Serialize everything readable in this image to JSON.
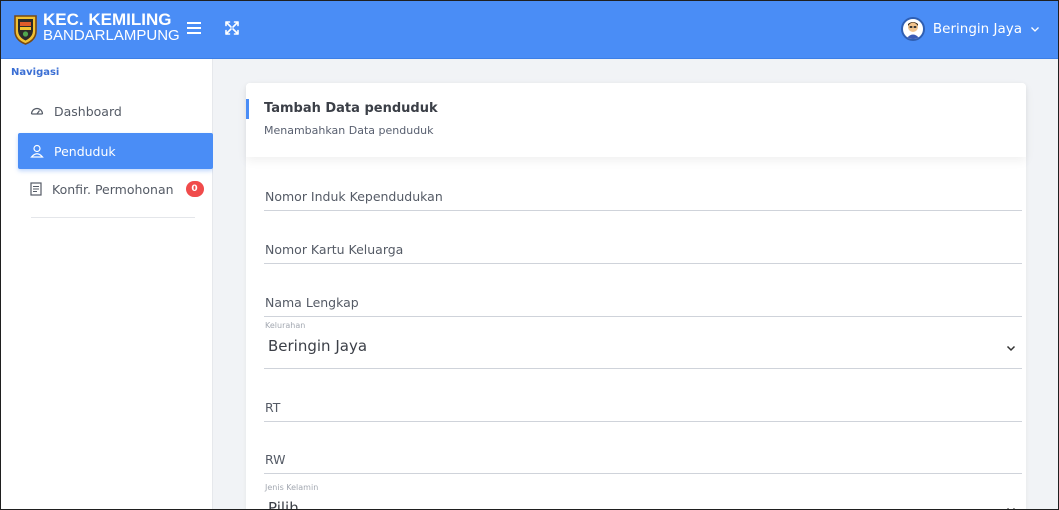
{
  "header": {
    "brand_title": "KEC. KEMILING",
    "brand_subtitle": "BANDARLAMPUNG",
    "user_name": "Beringin Jaya",
    "bar_color": "#4a8df6"
  },
  "sidebar": {
    "heading": "Navigasi",
    "items": [
      {
        "label": "Dashboard",
        "icon": "dashboard-gauge-icon",
        "active": false
      },
      {
        "label": "Penduduk",
        "icon": "user-icon",
        "active": true
      },
      {
        "label": "Konfir. Permohonan",
        "icon": "document-icon",
        "active": false,
        "badge": "0"
      }
    ]
  },
  "card": {
    "title": "Tambah Data penduduk",
    "subtitle": "Menambahkan Data penduduk"
  },
  "form": {
    "nik_placeholder": "Nomor Induk Kependudukan",
    "kk_placeholder": "Nomor Kartu Keluarga",
    "nama_placeholder": "Nama Lengkap",
    "kelurahan": {
      "label": "Kelurahan",
      "value": "Beringin Jaya"
    },
    "rt_placeholder": "RT",
    "rw_placeholder": "RW",
    "jenis_kelamin": {
      "label": "Jenis Kelamin",
      "value": "Pilih"
    }
  }
}
